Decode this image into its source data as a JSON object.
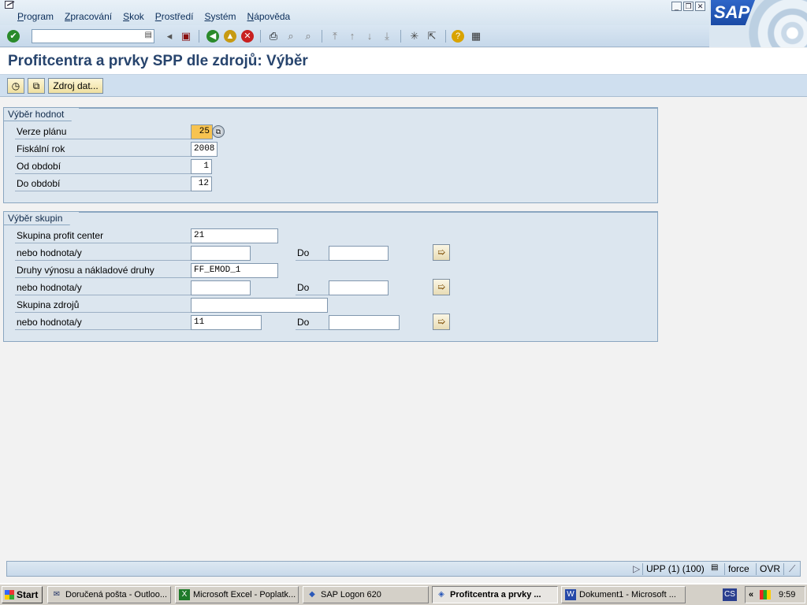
{
  "menu": [
    "Program",
    "Zpracování",
    "Skok",
    "Prostředí",
    "Systém",
    "Nápověda"
  ],
  "sap_logo": "SAP",
  "title": "Profitcentra a prvky SPP dle zdrojů: Výběr",
  "app_toolbar": {
    "data_source_label": "Zdroj dat..."
  },
  "value_selection": {
    "title": "Výběr hodnot",
    "plan_version_label": "Verze plánu",
    "plan_version_value": "25",
    "fiscal_year_label": "Fiskální rok",
    "fiscal_year_value": "2008",
    "from_period_label": "Od období",
    "from_period_value": "1",
    "to_period_label": "Do období",
    "to_period_value": "12"
  },
  "group_selection": {
    "title": "Výběr skupin",
    "profit_center_group_label": "Skupina profit center",
    "profit_center_group_value": "21",
    "or_values_label": "nebo hodnota/y",
    "to_label": "Do",
    "cost_element_label": "Druhy výnosu a nákladové druhy",
    "cost_element_value": "FF_EMOD_1",
    "source_group_label": "Skupina zdrojů",
    "source_values_value": "11"
  },
  "statusbar": {
    "session": "UPP (1) (100)",
    "mode": "force",
    "ovr": "OVR"
  },
  "taskbar": {
    "start": "Start",
    "tasks": [
      "Doručená pošta - Outloo...",
      "Microsoft Excel - Poplatk...",
      "SAP Logon 620",
      "Profitcentra a prvky ...",
      "Dokument1 - Microsoft ..."
    ],
    "lang": "CS",
    "time": "9:59"
  }
}
